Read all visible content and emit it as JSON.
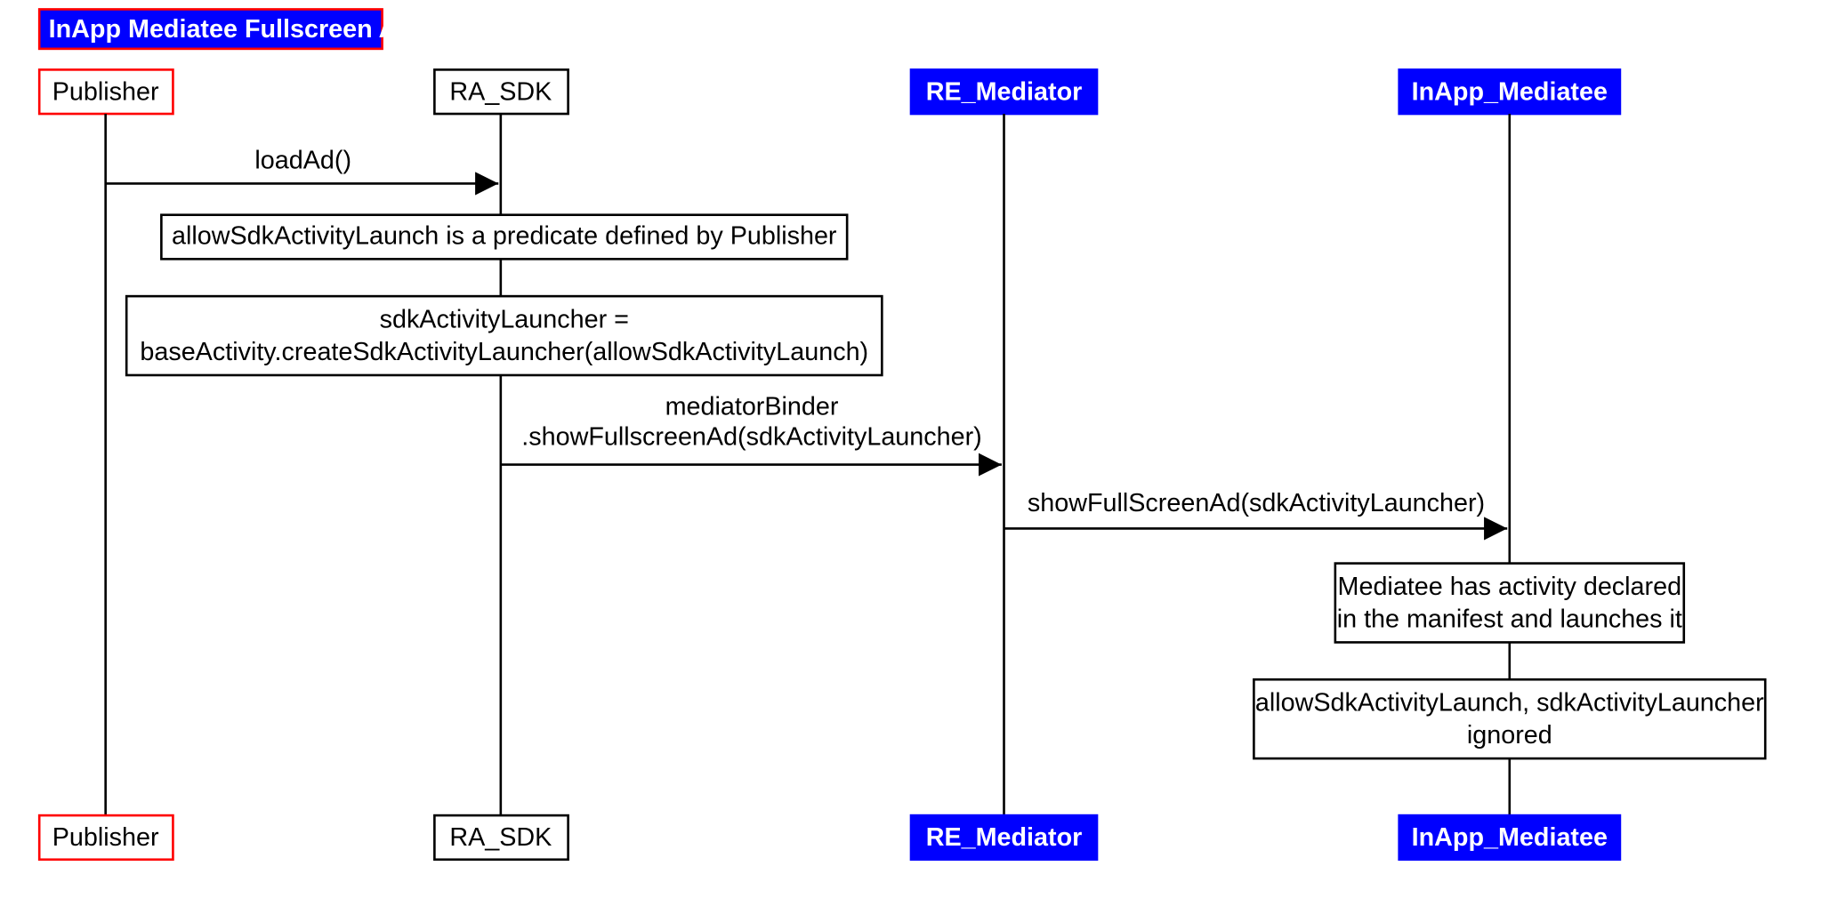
{
  "title": "InApp Mediatee Fullscreen Ad",
  "actors": {
    "publisher": "Publisher",
    "ra_sdk": "RA_SDK",
    "re_mediator": "RE_Mediator",
    "inapp_mediatee": "InApp_Mediatee"
  },
  "messages": {
    "loadAd": "loadAd()",
    "mediatorBinder_line1": "mediatorBinder",
    "mediatorBinder_line2": ".showFullscreenAd(sdkActivityLauncher)",
    "showFullScreenAd": "showFullScreenAd(sdkActivityLauncher)"
  },
  "notes": {
    "note1": "allowSdkActivityLaunch is a predicate defined by Publisher",
    "note2_line1": "sdkActivityLauncher =",
    "note2_line2": "baseActivity.createSdkActivityLauncher(allowSdkActivityLaunch)",
    "note3_line1": "Mediatee has activity declared",
    "note3_line2": "in the manifest and launches it",
    "note4_line1": "allowSdkActivityLaunch, sdkActivityLauncher",
    "note4_line2": "ignored"
  }
}
